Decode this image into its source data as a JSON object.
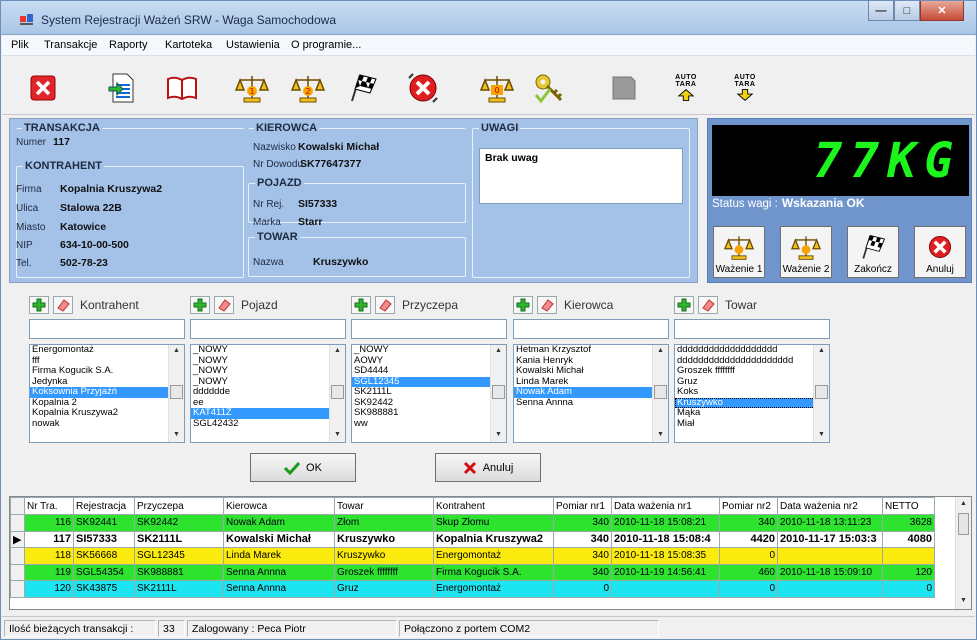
{
  "window": {
    "title": "System Rejestracji Ważeń SRW - Waga Samochodowa"
  },
  "menu": [
    "Plik",
    "Transakcje",
    "Raporty",
    "Kartoteka",
    "Ustawienia",
    "O programie..."
  ],
  "toolbar": {
    "items": [
      "close-icon",
      "new-document-icon",
      "book-icon",
      "scale-1-icon",
      "scale-2-icon",
      "checkered-flag-icon",
      "cancel-icon",
      "scale-zero-icon",
      "key-icon",
      "camera-icon",
      "auto-tara-up-icon",
      "auto-tara-down-icon"
    ],
    "auto_tara_1": "AUTO TARA",
    "auto_tara_2": "AUTO TARA"
  },
  "transakcja": {
    "legend": "TRANSAKCJA",
    "numer_label": "Numer",
    "numer": "117"
  },
  "kontrahent": {
    "legend": "KONTRAHENT",
    "firma_label": "Firma",
    "firma": "Kopalnia Kruszywa2",
    "ulica_label": "Ulica",
    "ulica": "Stalowa 22B",
    "miasto_label": "Miasto",
    "miasto": "Katowice",
    "nip_label": "NIP",
    "nip": "634-10-00-500",
    "tel_label": "Tel.",
    "tel": "502-78-23"
  },
  "kierowca": {
    "legend": "KIEROWCA",
    "nazwisko_label": "Nazwisko",
    "nazwisko": "Kowalski Michał",
    "dowod_label": "Nr Dowodu",
    "dowod": "SK77647377"
  },
  "pojazd": {
    "legend": "POJAZD",
    "nrrej_label": "Nr Rej.",
    "nrrej": "SI57333",
    "marka_label": "Marka",
    "marka": "Starr"
  },
  "towar": {
    "legend": "TOWAR",
    "nazwa_label": "Nazwa",
    "nazwa": "Kruszywko"
  },
  "uwagi": {
    "legend": "UWAGI",
    "text": "Brak uwag"
  },
  "scale": {
    "display": "77KG",
    "status_label": "Status wagi :",
    "status_value": "Wskazania OK",
    "buttons": [
      "Ważenie 1",
      "Ważenie 2",
      "Zakończ",
      "Anuluj"
    ]
  },
  "selectors": [
    {
      "title": "Kontrahent",
      "items": [
        "Energomontaż",
        "fff",
        "Firma Kogucik S.A.",
        "Jedynka",
        "Koksownia Przyjaźń",
        "Kopalnia 2",
        "Kopalnia Kruszywa2",
        "nowak"
      ],
      "selected": 4,
      "focus": -1
    },
    {
      "title": "Pojazd",
      "items": [
        "_NOWY",
        "_NOWY",
        "_NOWY",
        "_NOWY",
        "dddddde",
        "ee",
        "KAT411Z",
        "SGL42432"
      ],
      "selected": 6,
      "focus": -1
    },
    {
      "title": "Przyczepa",
      "items": [
        "_NOWY",
        "AOWY",
        "SD4444",
        "SGL12345",
        "SK2111L",
        "SK92442",
        "SK988881",
        "ww"
      ],
      "selected": 3,
      "focus": -1
    },
    {
      "title": "Kierowca",
      "items": [
        "Hetman Krzysztof",
        "Kania Henryk",
        "Kowalski Michał",
        "Linda Marek",
        "Nowak Adam",
        "Senna Annna"
      ],
      "selected": 4,
      "focus": -1
    },
    {
      "title": "Towar",
      "items": [
        "ddddddddddddddddddd",
        "dddddddddddddddddddddd",
        "Groszek ffffffff",
        "Gruz",
        "Koks",
        "Kruszywko",
        "Mąka",
        "Miał"
      ],
      "selected": -1,
      "focus": 5
    }
  ],
  "dialog": {
    "ok": "OK",
    "cancel": "Anuluj"
  },
  "table": {
    "headers": [
      "Nr Tra.",
      "Rejestracja",
      "Przyczepa",
      "Kierowca",
      "Towar",
      "Kontrahent",
      "Pomiar nr1",
      "Data ważenia nr1",
      "Pomiar nr2",
      "Data ważenia nr2",
      "NETTO"
    ],
    "rows": [
      {
        "style": "green",
        "cells": [
          "116",
          "SK92441",
          "SK92442",
          "Nowak Adam",
          "Złom",
          "Skup Złomu",
          "340",
          "2010-11-18 15:08:21",
          "340",
          "2010-11-18 13:11:23",
          "3628"
        ]
      },
      {
        "style": "sel",
        "cells": [
          "117",
          "SI57333",
          "SK2111L",
          "Kowalski Michał",
          "Kruszywko",
          "Kopalnia Kruszywa2",
          "340",
          "2010-11-18 15:08:4",
          "4420",
          "2010-11-17 15:03:3",
          "4080"
        ]
      },
      {
        "style": "yellow",
        "cells": [
          "118",
          "SK56668",
          "SGL12345",
          "Linda Marek",
          "Kruszywko",
          "Energomontaż",
          "340",
          "2010-11-18 15:08:35",
          "0",
          "",
          ""
        ]
      },
      {
        "style": "green",
        "cells": [
          "119",
          "SGL54354",
          "SK988881",
          "Senna Annna",
          "Groszek ffffffff",
          "Firma Kogucik S.A.",
          "340",
          "2010-11-19 14:56:41",
          "460",
          "2010-11-18 15:09:10",
          "120"
        ]
      },
      {
        "style": "cyan",
        "cells": [
          "120",
          "SK43875",
          "SK2111L",
          "Senna Annna",
          "Gruz",
          "Energomontaż",
          "0",
          "",
          "0",
          "",
          "0"
        ]
      }
    ]
  },
  "statusbar": {
    "count_label": "Ilość bieżących transakcji :",
    "count": "33",
    "user": "Zalogowany : Peca Piotr",
    "port": "Połączono z portem COM2"
  },
  "colors": {
    "panel": "#a4c2e8",
    "lcd_text": "#1df61d",
    "row_green": "#2ee32e",
    "row_yellow": "#fbea0d",
    "row_cyan": "#1ce4f0",
    "selection": "#3399ff"
  }
}
